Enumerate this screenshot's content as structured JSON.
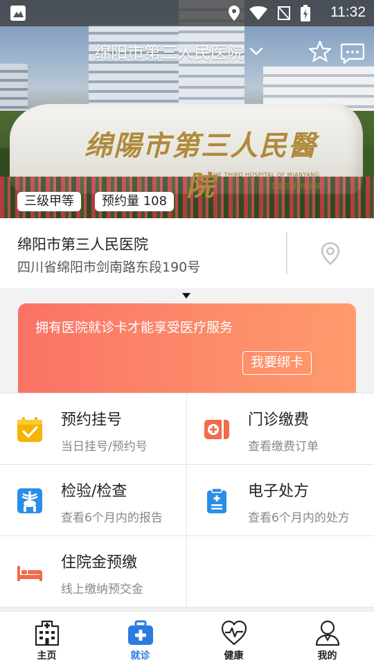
{
  "status_bar": {
    "time": "11:32"
  },
  "header": {
    "title": "绵阳市第三人民医院",
    "stone_title": "绵陽市第三人民醫院",
    "stone_english": "THE THIRD HOSPITAL OF MIANYANG",
    "stone_subtitle": "国家三级甲等医院",
    "badges": {
      "level": "三级甲等",
      "appointments": "预约量 108"
    }
  },
  "hospital_info": {
    "name": "绵阳市第三人民医院",
    "address": "四川省绵阳市剑南路东段190号"
  },
  "bind_card": {
    "message": "拥有医院就诊卡才能享受医疗服务",
    "button": "我要绑卡"
  },
  "services": [
    {
      "title": "预约挂号",
      "subtitle": "当日挂号/预约号",
      "icon": "calendar-check-icon",
      "color": "#f5b400"
    },
    {
      "title": "门诊缴费",
      "subtitle": "查看缴费订单",
      "icon": "clinic-payment-icon",
      "color": "#f26b4a"
    },
    {
      "title": "检验/检查",
      "subtitle": "查看6个月内的报告",
      "icon": "skeleton-icon",
      "color": "#2a8ee8"
    },
    {
      "title": "电子处方",
      "subtitle": "查看6个月内的处方",
      "icon": "prescription-icon",
      "color": "#2a8ee8"
    },
    {
      "title": "住院金预缴",
      "subtitle": "线上缴纳预交金",
      "icon": "hospital-bed-icon",
      "color": "#f26b4a"
    }
  ],
  "nav": {
    "items": [
      {
        "label": "主页",
        "icon": "hospital-icon",
        "active": false
      },
      {
        "label": "就诊",
        "icon": "medical-kit-icon",
        "active": true
      },
      {
        "label": "健康",
        "icon": "heart-pulse-icon",
        "active": false
      },
      {
        "label": "我的",
        "icon": "user-icon",
        "active": false
      }
    ]
  },
  "colors": {
    "accent": "#2b7be0",
    "card_gradient_start": "#fa7366",
    "card_gradient_end": "#ff9b6c"
  }
}
